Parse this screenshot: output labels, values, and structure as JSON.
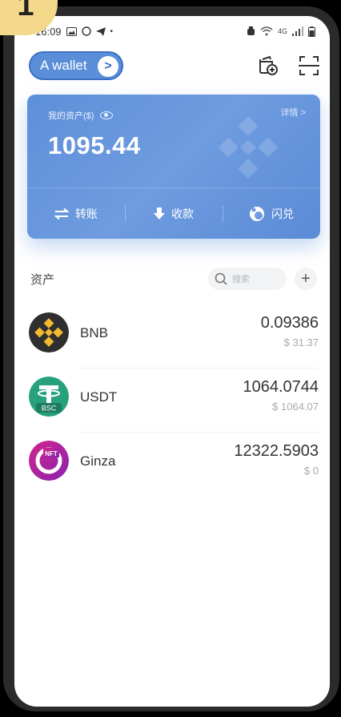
{
  "badge": {
    "label": "1"
  },
  "status_bar": {
    "time": "16:09",
    "network": "4G"
  },
  "header": {
    "wallet_name": "A wallet",
    "wallet_arrow": ">"
  },
  "card": {
    "label": "我的资产($)",
    "detail_label": "详情 >",
    "total": "1095.44",
    "actions": [
      {
        "label": "转账",
        "icon": "transfer-icon"
      },
      {
        "label": "收款",
        "icon": "receive-icon"
      },
      {
        "label": "闪兑",
        "icon": "swap-icon"
      }
    ]
  },
  "assets": {
    "title": "资产",
    "search_placeholder": "搜索",
    "add_label": "+"
  },
  "tokens": [
    {
      "name": "BNB",
      "amount": "0.09386",
      "value": "$ 31.37",
      "icon": "bnb-icon"
    },
    {
      "name": "USDT",
      "amount": "1064.0744",
      "value": "$ 1064.07",
      "icon": "usdt-bsc-icon",
      "icon_text": "BSC"
    },
    {
      "name": "Ginza",
      "amount": "12322.5903",
      "value": "$ 0",
      "icon": "ginza-nft-icon",
      "icon_text": "NFT"
    }
  ],
  "colors": {
    "accent": "#5b8ed9",
    "card_blue": "#6f9ce0",
    "bnb_yellow": "#f3ba2f",
    "usdt_green": "#26a17b",
    "ginza_purple": "#b0208e"
  }
}
